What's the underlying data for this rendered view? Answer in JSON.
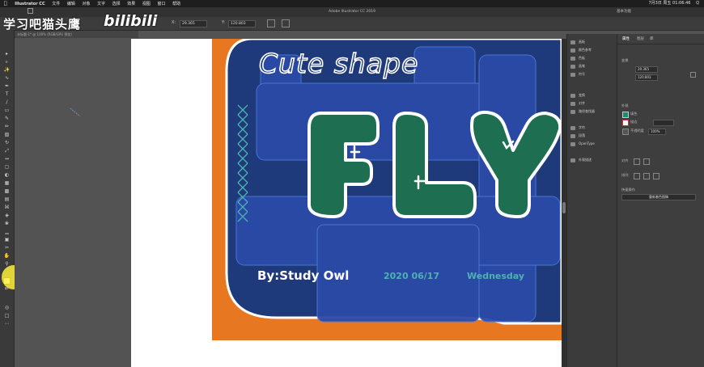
{
  "menubar": {
    "app": "Illustrator CC",
    "items": [
      "文件",
      "编辑",
      "对象",
      "文字",
      "选择",
      "效果",
      "视图",
      "窗口",
      "帮助"
    ],
    "right_date": "7月3日 周五 01:06:46",
    "right_search": "Q"
  },
  "appbar": {
    "title": "Adobe Illustrator CC 2019",
    "workspace": "基本功能"
  },
  "ctrlbar": {
    "x_value": "29.365",
    "y_value": "120.803",
    "x_label": "X:",
    "y_label": "Y:"
  },
  "watermark": {
    "channel": "学习吧猫头鹰",
    "logo": "bilibili"
  },
  "doctab": {
    "label": "未标题-1* @ 100% (RGB/GPU 预览)"
  },
  "artwork": {
    "headline": "Cute shape",
    "title_word": "FLY",
    "byline": "By:Study Owl",
    "date": "2020  06/17",
    "weekday": "Wednesday",
    "colors": {
      "orange": "#e87722",
      "navy": "#1f3a7a",
      "blue": "#2b4aa8",
      "green": "#1e6e52",
      "teal": "#4bb3b0",
      "white": "#ffffff"
    }
  },
  "panels": {
    "icon_items": [
      "画板",
      "颜色参考",
      "色板",
      "画笔",
      "符号",
      "变换",
      "对齐",
      "路径查找器",
      "字符",
      "段落",
      "OpenType",
      "外观描述"
    ],
    "tabs": [
      "属性",
      "图层",
      "库"
    ],
    "transform_label": "变换",
    "x_value": "29.365",
    "y_value": "120.803",
    "appearance_label": "外观",
    "fill_label": "填色",
    "stroke_label": "描边",
    "opacity_label": "不透明度",
    "opacity_value": "100%",
    "quick_actions_label": "快速操作",
    "align_label": "对齐",
    "arrange_label": "排列",
    "recolor_button": "重新着色图稿"
  }
}
